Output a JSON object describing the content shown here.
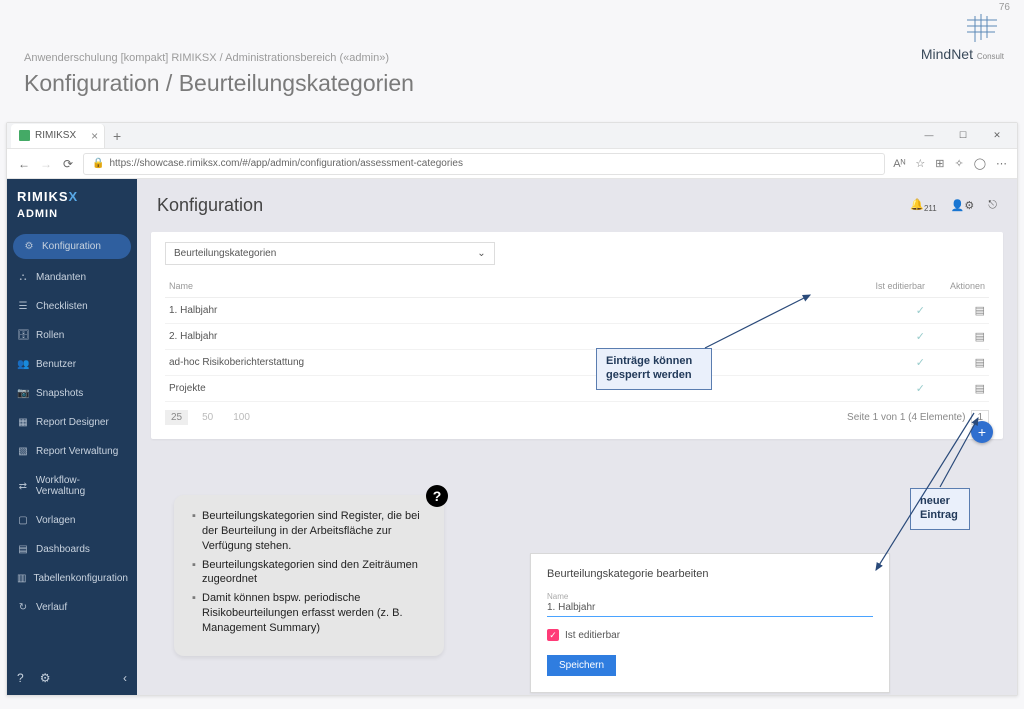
{
  "slide": {
    "breadcrumb": "Anwenderschulung [kompakt] RIMIKSX / Administrationsbereich («admin»)",
    "title": "Konfiguration / Beurteilungskategorien",
    "page_number": "76",
    "brand": "MindNet",
    "brand_suffix": "Consult"
  },
  "browser": {
    "tab_title": "RIMIKSX",
    "url": "https://showcase.rimiksx.com/#/app/admin/configuration/assessment-categories"
  },
  "sidebar": {
    "product": "RIMIKS",
    "product_x": "X",
    "role": "ADMIN",
    "items": [
      {
        "icon": "⚙",
        "label": "Konfiguration"
      },
      {
        "icon": "⛬",
        "label": "Mandanten"
      },
      {
        "icon": "☰",
        "label": "Checklisten"
      },
      {
        "icon": "🗄",
        "label": "Rollen"
      },
      {
        "icon": "👥",
        "label": "Benutzer"
      },
      {
        "icon": "📷",
        "label": "Snapshots"
      },
      {
        "icon": "▦",
        "label": "Report Designer"
      },
      {
        "icon": "▧",
        "label": "Report Verwaltung"
      },
      {
        "icon": "⇄",
        "label": "Workflow-Verwaltung"
      },
      {
        "icon": "▢",
        "label": "Vorlagen"
      },
      {
        "icon": "▤",
        "label": "Dashboards"
      },
      {
        "icon": "▥",
        "label": "Tabellenkonfiguration"
      },
      {
        "icon": "↻",
        "label": "Verlauf"
      }
    ]
  },
  "content": {
    "heading": "Konfiguration",
    "notif_count": "211",
    "dropdown_selected": "Beurteilungskategorien",
    "columns": {
      "name": "Name",
      "editable": "Ist editierbar",
      "actions": "Aktionen"
    },
    "rows": [
      {
        "name": "1. Halbjahr"
      },
      {
        "name": "2. Halbjahr"
      },
      {
        "name": "ad-hoc Risikoberichterstattung"
      },
      {
        "name": "Projekte"
      }
    ],
    "page_sizes": [
      "25",
      "50",
      "100"
    ],
    "pager_text": "Seite 1 von 1 (4 Elemente)",
    "pager_current": "1"
  },
  "callouts": {
    "lock": "Einträge können gesperrt werden",
    "new": "neuer Eintrag"
  },
  "help": {
    "items": [
      "Beurteilungskategorien sind Register, die bei der Beurteilung in der Arbeitsfläche zur Verfügung stehen.",
      "Beurteilungskategorien sind den Zeiträumen zugeordnet",
      "Damit können bspw. periodische Risikobeurteilungen erfasst werden (z. B. Management Summary)"
    ]
  },
  "edit": {
    "title": "Beurteilungskategorie bearbeiten",
    "field_label": "Name",
    "field_value": "1. Halbjahr",
    "checkbox_label": "Ist editierbar",
    "save": "Speichern"
  }
}
